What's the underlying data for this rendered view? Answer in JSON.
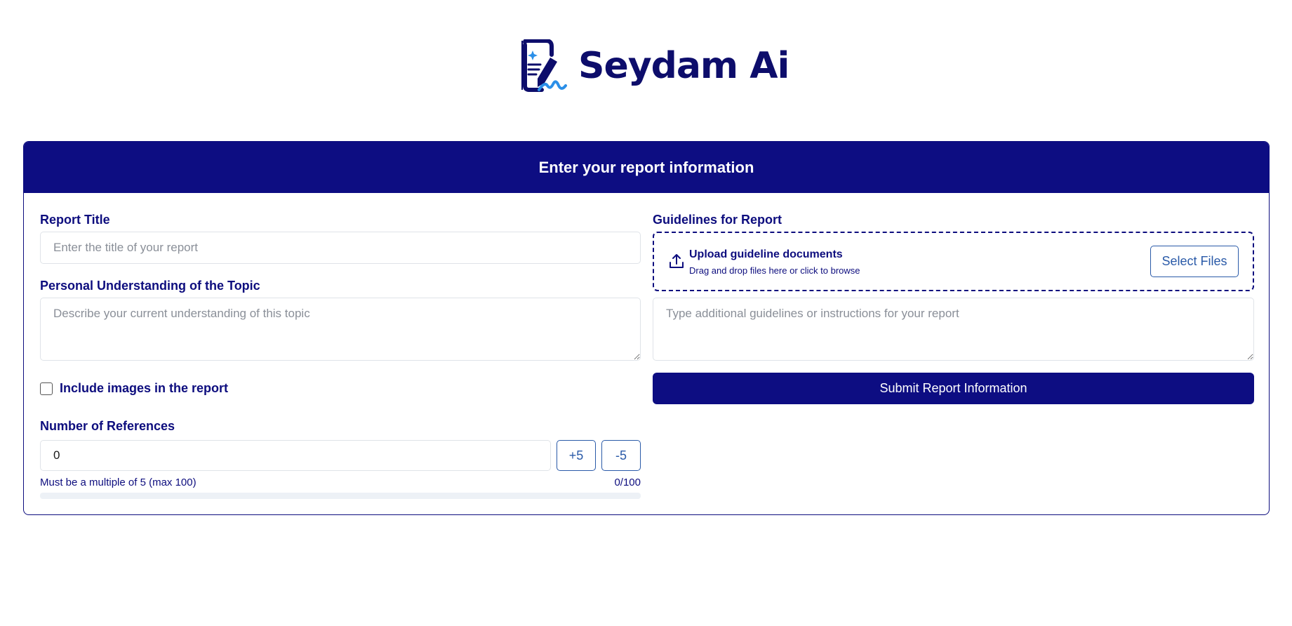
{
  "brand": {
    "name": "Seydam Ai",
    "colors": {
      "primary": "#0d0d82",
      "accent": "#2b8fe8",
      "button_outline": "#2a5aa8"
    }
  },
  "form": {
    "header_title": "Enter your report information",
    "report_title": {
      "label": "Report Title",
      "placeholder": "Enter the title of your report",
      "value": ""
    },
    "understanding": {
      "label": "Personal Understanding of the Topic",
      "placeholder": "Describe your current understanding of this topic",
      "value": ""
    },
    "include_images": {
      "label": "Include images in the report",
      "checked": false
    },
    "references": {
      "label": "Number of References",
      "value": "0",
      "plus_label": "+5",
      "minus_label": "-5",
      "hint": "Must be a multiple of 5 (max 100)",
      "count_text": "0/100",
      "progress": 0
    },
    "guidelines": {
      "label": "Guidelines for Report",
      "upload_title": "Upload guideline documents",
      "upload_subtitle": "Drag and drop files here or click to browse",
      "select_files_label": "Select Files",
      "upload_icon": "upload-icon",
      "placeholder": "Type additional guidelines or instructions for your report",
      "value": ""
    },
    "submit_label": "Submit Report Information"
  }
}
